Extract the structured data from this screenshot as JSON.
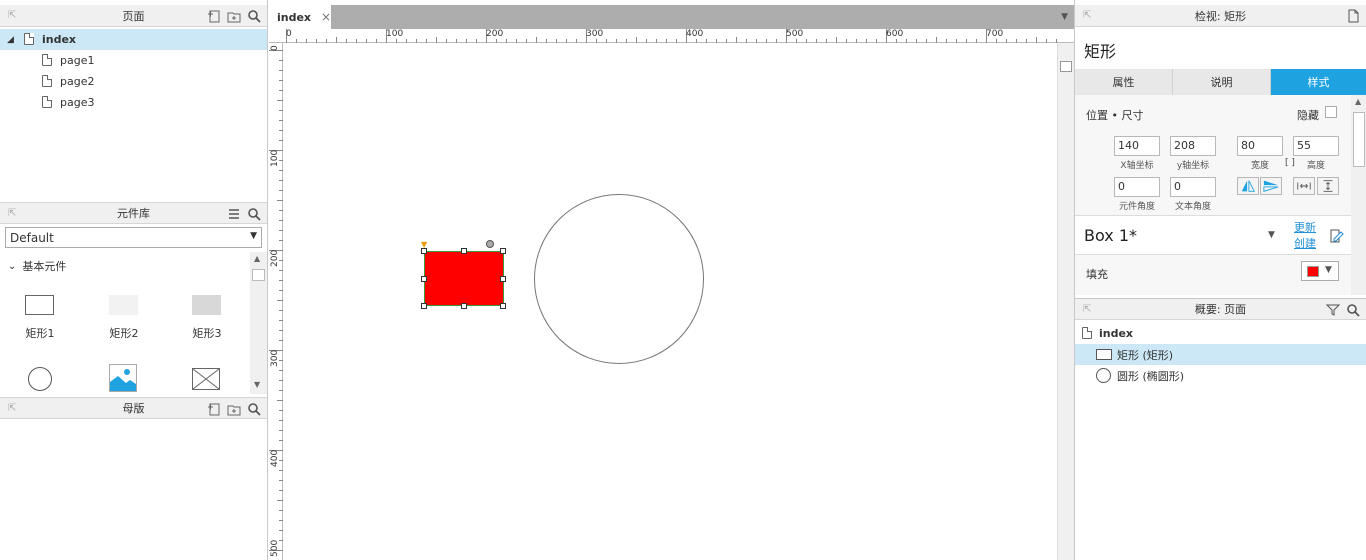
{
  "pages_panel": {
    "title": "页面",
    "items": [
      {
        "label": "index"
      },
      {
        "label": "page1"
      },
      {
        "label": "page2"
      },
      {
        "label": "page3"
      }
    ]
  },
  "library_panel": {
    "title": "元件库",
    "dropdown_value": "Default",
    "section_title": "基本元件",
    "widgets": [
      {
        "label": "矩形1"
      },
      {
        "label": "矩形2"
      },
      {
        "label": "矩形3"
      }
    ]
  },
  "masters_panel": {
    "title": "母版"
  },
  "canvas": {
    "tab_label": "index",
    "tab_close": "×",
    "ruler_top_labels": [
      "0",
      "100",
      "200",
      "300",
      "400",
      "500",
      "600",
      "700"
    ],
    "ruler_left_labels": [
      "0",
      "100",
      "200",
      "300",
      "400",
      "500"
    ]
  },
  "inspector": {
    "title": "检视: 矩形",
    "shape_name": "矩形",
    "tabs": [
      {
        "label": "属性"
      },
      {
        "label": "说明"
      },
      {
        "label": "样式"
      }
    ],
    "position_title": "位置 • 尺寸",
    "hide_label": "隐藏",
    "x_value": "140",
    "x_label": "X轴坐标",
    "y_value": "208",
    "y_label": "y轴坐标",
    "w_value": "80",
    "w_label": "宽度",
    "h_value": "55",
    "h_label": "高度",
    "rot_value": "0",
    "rot_label": "元件角度",
    "text_rot_value": "0",
    "text_rot_label": "文本角度",
    "style_name": "Box 1*",
    "update_label": "更新",
    "create_label": "创建",
    "fill_label": "填充",
    "fill_color": "#ff0000"
  },
  "outline_panel": {
    "title": "概要: 页面",
    "root": "index",
    "items": [
      {
        "label": "矩形 (矩形)"
      },
      {
        "label": "圆形 (椭圆形)"
      }
    ]
  },
  "colors": {
    "accent": "#1fa3e0",
    "selection_row": "#cce8f6",
    "rect_fill": "#ff0000"
  }
}
